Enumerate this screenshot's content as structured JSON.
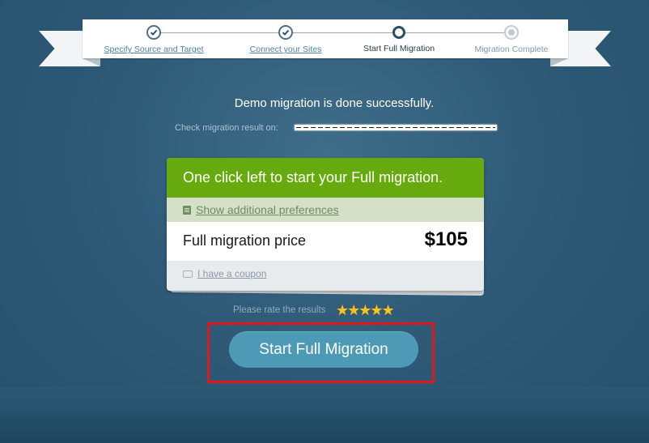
{
  "steps": [
    {
      "label": "Specify Source and Target",
      "state": "done"
    },
    {
      "label": "Connect your Sites",
      "state": "done"
    },
    {
      "label": "Start Full Migration",
      "state": "current"
    },
    {
      "label": "Migration Complete",
      "state": "future"
    }
  ],
  "message": "Demo migration is done successfully.",
  "check_label": "Check migration result on:",
  "card": {
    "header": "One click left to start your Full migration.",
    "preferences_link": "Show additional preferences",
    "price_label": "Full migration price",
    "price_value": "$105",
    "coupon_link": "I have a coupon"
  },
  "rating": {
    "label": "Please rate the results",
    "stars": "★★★★★",
    "max": 5
  },
  "start_button": "Start Full Migration",
  "colors": {
    "header_green": "#66aa0e",
    "button_blue": "#4c9ab5",
    "highlight_red": "#e3161c",
    "background": "#2f5b78"
  }
}
